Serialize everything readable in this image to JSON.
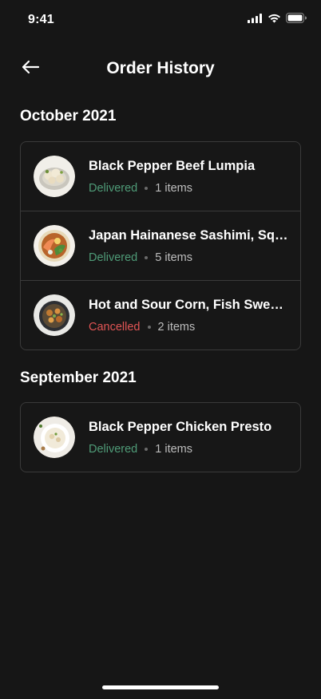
{
  "status_bar": {
    "time": "9:41"
  },
  "header": {
    "title": "Order History"
  },
  "sections": [
    {
      "title": "October 2021",
      "orders": [
        {
          "name": "Black Pepper Beef Lumpia",
          "status": "Delivered",
          "items": "1 items"
        },
        {
          "name": "Japan Hainanese Sashimi, Squid",
          "status": "Delivered",
          "items": "5 items"
        },
        {
          "name": "Hot and Sour Corn, Fish Sweet Soup",
          "status": "Cancelled",
          "items": "2 items"
        }
      ]
    },
    {
      "title": "September 2021",
      "orders": [
        {
          "name": "Black Pepper Chicken Presto",
          "status": "Delivered",
          "items": "1 items"
        }
      ]
    }
  ],
  "colors": {
    "background": "#161616",
    "delivered": "#4f9c78",
    "cancelled": "#e25555",
    "border": "#3a3a3a"
  },
  "icons": {
    "back": "arrow-left-icon",
    "signal": "cellular-signal-icon",
    "wifi": "wifi-icon",
    "battery": "battery-icon"
  }
}
